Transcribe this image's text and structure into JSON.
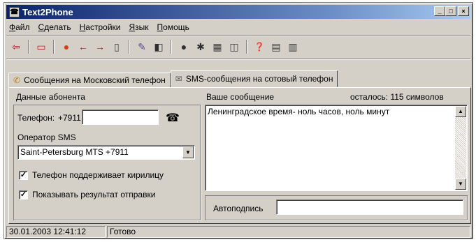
{
  "window": {
    "title": "Text2Phone"
  },
  "menu": [
    "Файл",
    "Сделать",
    "Настройки",
    "Язык",
    "Помощь"
  ],
  "toolbar": [
    {
      "icon": "back-icon",
      "glyph": "⇦"
    },
    {
      "icon": "message-icon",
      "glyph": "▭"
    },
    {
      "icon": "stop-icon",
      "glyph": "●"
    },
    {
      "icon": "arrow-left-icon",
      "glyph": "←"
    },
    {
      "icon": "arrow-right-icon",
      "glyph": "→"
    },
    {
      "icon": "document-icon",
      "glyph": "▯"
    },
    {
      "icon": "edit-icon",
      "glyph": "✎"
    },
    {
      "icon": "clear-icon",
      "glyph": "◧"
    },
    {
      "icon": "record-icon",
      "glyph": "●"
    },
    {
      "icon": "tools-icon",
      "glyph": "✱"
    },
    {
      "icon": "table-icon",
      "glyph": "▦"
    },
    {
      "icon": "preview-icon",
      "glyph": "◫"
    },
    {
      "icon": "help-icon",
      "glyph": "❓"
    },
    {
      "icon": "notes-icon",
      "glyph": "▤"
    },
    {
      "icon": "book-icon",
      "glyph": "▥"
    }
  ],
  "tabs": {
    "moscow": "Сообщения на Московский телефон",
    "sms": "SMS-сообщения на сотовый телефон"
  },
  "subscriber": {
    "section_label": "Данные абонента",
    "phone_label": "Телефон:",
    "phone_prefix": "+7911",
    "phone_value": "",
    "operator_label": "Оператор SMS",
    "operator_value": "Saint-Petersburg MTS +7911",
    "cyrillic_label": "Телефон поддерживает кирилицу",
    "show_result_label": "Показывать результат отправки"
  },
  "message": {
    "section_label": "Ваше сообщение",
    "remaining": "осталось: 115  символов",
    "text": "Ленинградское время- ноль часов, ноль минут",
    "autosign_label": "Автоподпись",
    "autosign_value": ""
  },
  "status": {
    "datetime": "30.01.2003 12:41:12",
    "state": "Готово"
  }
}
